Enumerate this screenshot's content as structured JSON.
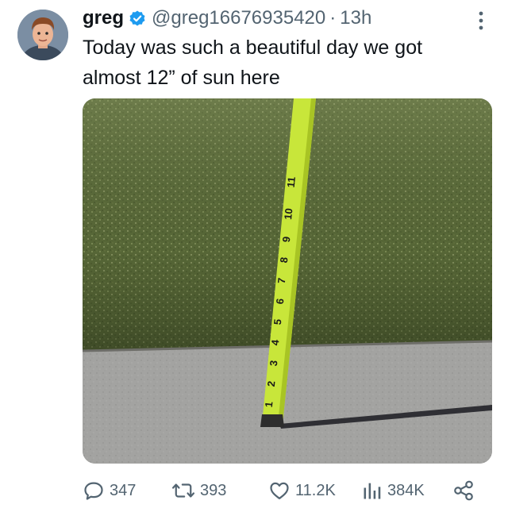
{
  "user": {
    "name": "greg",
    "handle": "@greg16676935420",
    "separator": "·",
    "time": "13h"
  },
  "tweet": {
    "text": "Today was such a beautiful day we got almost 12” of sun here"
  },
  "media": {
    "tape_numbers": [
      "1",
      "2",
      "3",
      "4",
      "5",
      "6",
      "7",
      "8",
      "9",
      "10",
      "11"
    ]
  },
  "actions": {
    "replies": "347",
    "reposts": "393",
    "likes": "11.2K",
    "views": "384K"
  },
  "icons": [
    "verified-badge-icon",
    "more-options-icon",
    "reply-icon",
    "repost-icon",
    "like-icon",
    "views-icon",
    "share-icon"
  ],
  "colors": {
    "verified": "#1d9bf0",
    "text": "#0f1419",
    "secondary": "#536471",
    "tape": "#c8e63a"
  }
}
